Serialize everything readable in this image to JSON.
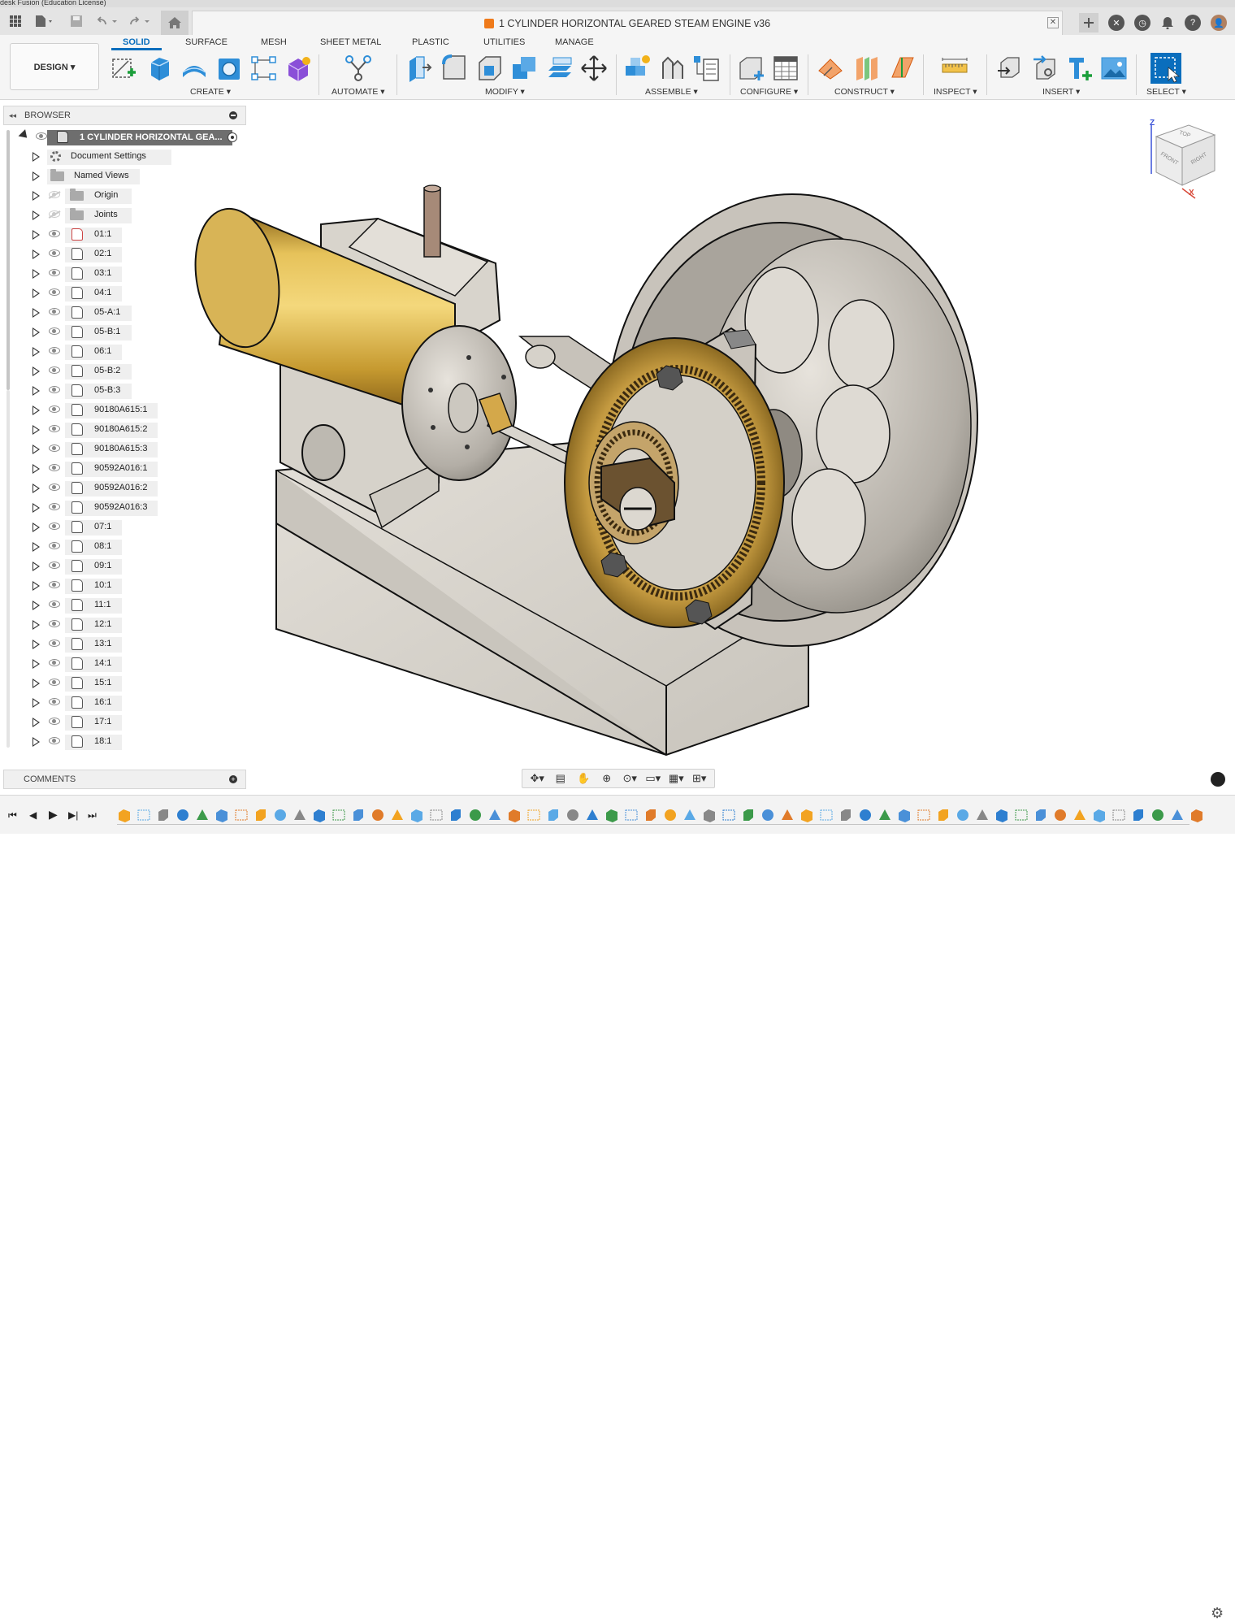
{
  "window": {
    "title_strip": "desk Fusion (Education License)"
  },
  "document": {
    "tab_title": "1 CYLINDER HORIZONTAL GEARED STEAM ENGINE v36",
    "close_glyph": "✕"
  },
  "workspace": {
    "design_label": "DESIGN ▾"
  },
  "ribbon": {
    "tabs": [
      "SOLID",
      "SURFACE",
      "MESH",
      "SHEET METAL",
      "PLASTIC",
      "UTILITIES",
      "MANAGE"
    ],
    "groups": [
      "CREATE ▾",
      "AUTOMATE ▾",
      "MODIFY ▾",
      "ASSEMBLE ▾",
      "CONFIGURE ▾",
      "CONSTRUCT ▾",
      "INSPECT ▾",
      "INSERT ▾",
      "SELECT ▾"
    ]
  },
  "browser": {
    "title": "BROWSER",
    "collapse_glyph": "◂◂",
    "root": "1 CYLINDER HORIZONTAL GEA...",
    "items": [
      {
        "label": "Document Settings",
        "icon": "gear-icon"
      },
      {
        "label": "Named Views",
        "icon": "folder-icon"
      },
      {
        "label": "Origin",
        "icon": "folder-icon",
        "hidden": true
      },
      {
        "label": "Joints",
        "icon": "folder-icon",
        "hidden": true
      },
      {
        "label": "01:1",
        "icon": "component-icon"
      },
      {
        "label": "02:1",
        "icon": "component-icon"
      },
      {
        "label": "03:1",
        "icon": "component-icon"
      },
      {
        "label": "04:1",
        "icon": "component-icon"
      },
      {
        "label": "05-A:1",
        "icon": "component-icon"
      },
      {
        "label": "05-B:1",
        "icon": "component-icon"
      },
      {
        "label": "06:1",
        "icon": "component-icon"
      },
      {
        "label": "05-B:2",
        "icon": "component-icon"
      },
      {
        "label": "05-B:3",
        "icon": "component-icon"
      },
      {
        "label": "90180A615:1",
        "icon": "component-icon"
      },
      {
        "label": "90180A615:2",
        "icon": "component-icon"
      },
      {
        "label": "90180A615:3",
        "icon": "component-icon"
      },
      {
        "label": "90592A016:1",
        "icon": "component-icon"
      },
      {
        "label": "90592A016:2",
        "icon": "component-icon"
      },
      {
        "label": "90592A016:3",
        "icon": "component-icon"
      },
      {
        "label": "07:1",
        "icon": "component-icon"
      },
      {
        "label": "08:1",
        "icon": "component-icon"
      },
      {
        "label": "09:1",
        "icon": "component-icon"
      },
      {
        "label": "10:1",
        "icon": "component-icon"
      },
      {
        "label": "11:1",
        "icon": "component-icon"
      },
      {
        "label": "12:1",
        "icon": "component-icon"
      },
      {
        "label": "13:1",
        "icon": "component-icon"
      },
      {
        "label": "14:1",
        "icon": "component-icon"
      },
      {
        "label": "15:1",
        "icon": "component-icon"
      },
      {
        "label": "16:1",
        "icon": "component-icon"
      },
      {
        "label": "17:1",
        "icon": "component-icon"
      },
      {
        "label": "18:1",
        "icon": "component-icon"
      }
    ]
  },
  "comments": {
    "title": "COMMENTS",
    "plus_glyph": "+"
  },
  "viewcube": {
    "top": "TOP",
    "front": "FRONT",
    "right": "RIGHT",
    "axis_z": "Z",
    "axis_x": "X"
  },
  "navbar": {
    "glyphs": [
      "✥▾",
      "▤",
      "✋",
      "⊕",
      "⊙▾",
      "▭▾",
      "▦▾",
      "⊞▾"
    ]
  },
  "timeline": {
    "controls": [
      "⏮",
      "◀",
      "▶",
      "▶|",
      "⏭"
    ],
    "feature_count": 56
  },
  "colors": {
    "accent": "#0a6ebd",
    "brass": "#c8a035",
    "steel": "#b8b3ab",
    "base": "#d8d4cc",
    "orange": "#ef7a1a"
  }
}
